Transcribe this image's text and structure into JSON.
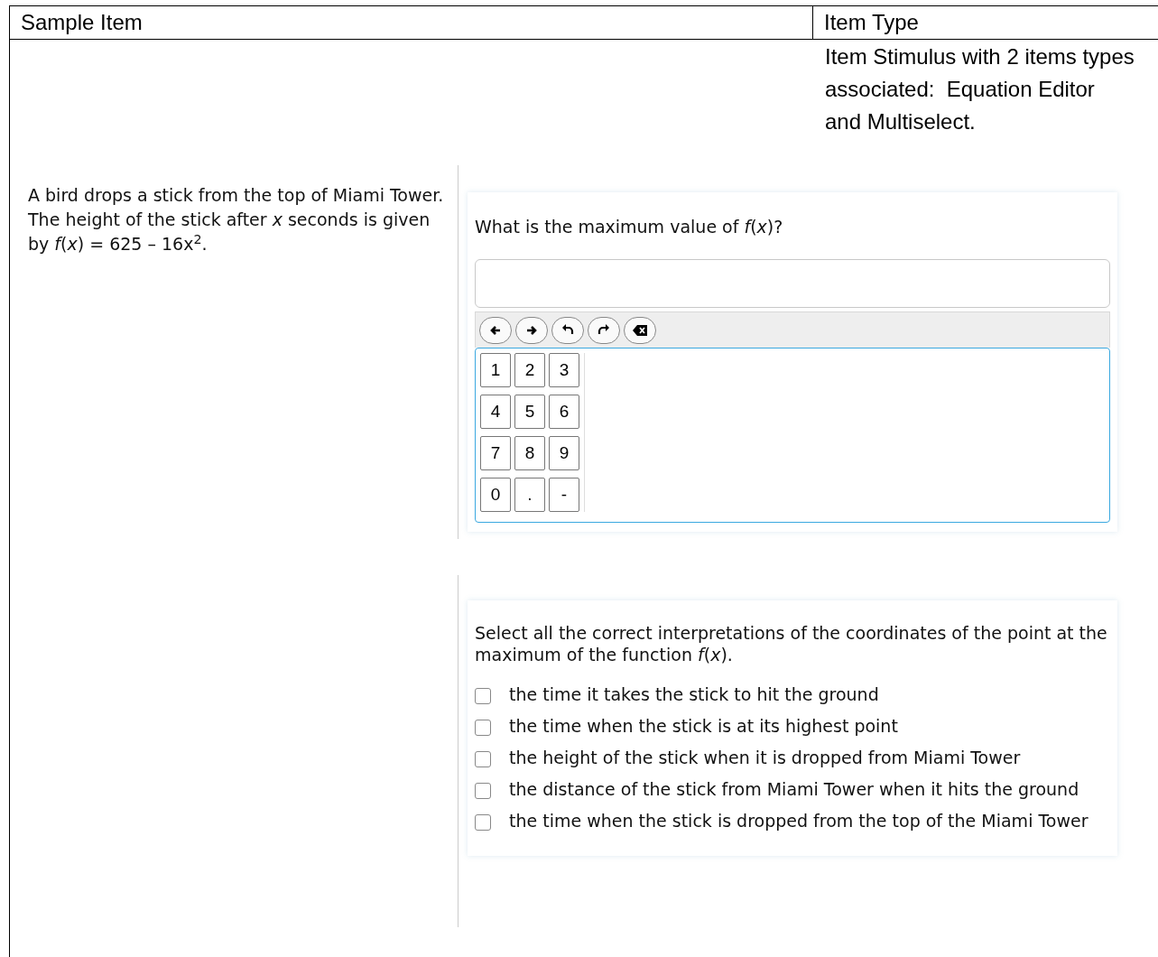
{
  "header": {
    "column_1": "Sample Item",
    "column_2": "Item Type"
  },
  "item_type": "Item Stimulus with 2 items types associated:  Equation Editor and Multiselect.",
  "stimulus": "A bird drops a stick from the top of Miami Tower. The height of the stick after *x* seconds is given by *f*(*x*) = 625 – 16x$^{2}$.",
  "question_1": {
    "prompt": "What is the maximum value of *f*(*x*)?",
    "keypad": [
      "1",
      "2",
      "3",
      "4",
      "5",
      "6",
      "7",
      "8",
      "9",
      "0",
      ".",
      "-"
    ]
  },
  "question_2": {
    "prompt": "Select all the correct interpretations of the coordinates of the point at the maximum of the function *f*(*x*).",
    "options": [
      {
        "label": "the time it takes the stick to hit the ground",
        "checked": false
      },
      {
        "label": "the time when the stick is at its highest point",
        "checked": false
      },
      {
        "label": "the height of the stick when it is dropped from Miami Tower",
        "checked": false
      },
      {
        "label": "the distance of the stick from Miami Tower when it hits the ground",
        "checked": false
      },
      {
        "label": "the time when the stick is dropped from the top of the Miami Tower",
        "checked": false
      }
    ]
  }
}
